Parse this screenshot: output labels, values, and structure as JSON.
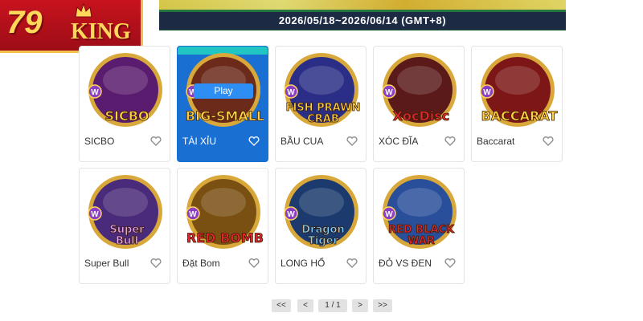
{
  "logo": {
    "number": "79",
    "word": "KING"
  },
  "banner": {
    "dates": "2026/05/18~2026/06/14 (GMT+8)"
  },
  "games": [
    {
      "label": "SICBO",
      "art_title": "SICBO",
      "ring": "#d9a83a",
      "bg": "#5a1c6e",
      "text_color": "#ffd342"
    },
    {
      "label": "TÀI XỈU",
      "art_title": "BIG-SMALL",
      "ring": "#d9a83a",
      "bg": "#6b2a1a",
      "text_color": "#ffd342",
      "active": true,
      "play_label": "Play"
    },
    {
      "label": "BẦU CUA",
      "art_title": "FISH PRAWN CRAB",
      "ring": "#d9a83a",
      "bg": "#2b2e86",
      "text_color": "#ffd342"
    },
    {
      "label": "XÓC ĐĨA",
      "art_title": "XocDisc",
      "ring": "#d9a83a",
      "bg": "#5b1a1a",
      "text_color": "#e2272e"
    },
    {
      "label": "Baccarat",
      "art_title": "BACCARAT",
      "ring": "#d9a83a",
      "bg": "#7d1717",
      "text_color": "#ffd342"
    },
    {
      "label": "Super Bull",
      "art_title": "Super Bull",
      "ring": "#d9a83a",
      "bg": "#4a2a7a",
      "text_color": "#e8a6ff"
    },
    {
      "label": "Đặt Bom",
      "art_title": "RED BOMB",
      "ring": "#d9a83a",
      "bg": "#7a4f12",
      "text_color": "#e2272e"
    },
    {
      "label": "LONG HỔ",
      "art_title": "Dragon Tiger",
      "ring": "#d9a83a",
      "bg": "#1c3a6e",
      "text_color": "#7ed0ff"
    },
    {
      "label": "ĐỎ VS ĐEN",
      "art_title": "RED BLACK WAR",
      "ring": "#d9a83a",
      "bg": "#2a4f9a",
      "text_color": "#e2272e"
    }
  ],
  "pagination": {
    "first": "<<",
    "prev": "<",
    "page": "1 / 1",
    "next": ">",
    "last": ">>"
  }
}
